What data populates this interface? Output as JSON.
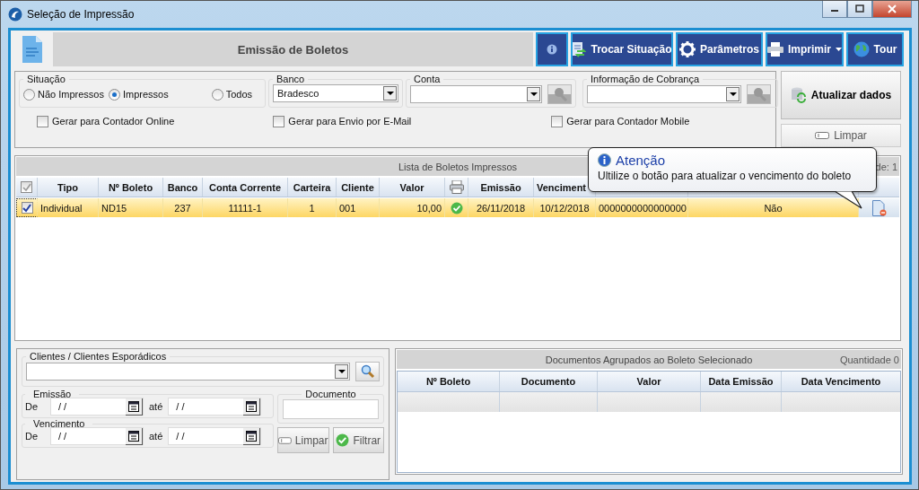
{
  "window": {
    "title": "Seleção de Impressão"
  },
  "header": {
    "title": "Emissão de Boletos",
    "buttons": [
      {
        "kind": "info"
      },
      {
        "kind": "swap",
        "label": "Trocar Situação"
      },
      {
        "kind": "gear",
        "label": "Parâmetros"
      },
      {
        "kind": "printer",
        "label": "Imprimir",
        "dropdown": true
      },
      {
        "kind": "globe",
        "label": "Tour"
      }
    ]
  },
  "filters": {
    "situacao": {
      "label": "Situação",
      "options": [
        {
          "label": "Não Impressos",
          "selected": false
        },
        {
          "label": "Impressos",
          "selected": true
        },
        {
          "label": "Todos",
          "selected": false
        }
      ]
    },
    "banco": {
      "label": "Banco",
      "value": "Bradesco"
    },
    "conta": {
      "label": "Conta"
    },
    "cobranca": {
      "label": "Informação de Cobrança"
    },
    "checkboxes": [
      {
        "label": "Gerar para Contador Online",
        "checked": false
      },
      {
        "label": "Gerar para Envio por E-Mail",
        "checked": false
      },
      {
        "label": "Gerar para Contador Mobile",
        "checked": false
      }
    ]
  },
  "actions": {
    "refresh": "Atualizar dados",
    "clear": "Limpar"
  },
  "list": {
    "title": "Lista de Boletos Impressos",
    "count": "de: 1",
    "all_checked": true,
    "columns": [
      {
        "label": "Tipo"
      },
      {
        "label": "Nº Boleto"
      },
      {
        "label": "Banco"
      },
      {
        "label": "Conta Corrente"
      },
      {
        "label": "Carteira"
      },
      {
        "label": "Cliente"
      },
      {
        "label": "Valor"
      },
      {
        "kind": "printer"
      },
      {
        "label": "Emissão"
      },
      {
        "label": "Venciment"
      }
    ],
    "rows": [
      {
        "checked": true,
        "selected": true,
        "printed": true,
        "cells": [
          "Individual",
          "ND15",
          "237",
          "11111-1",
          "1",
          "001",
          "10,00",
          "",
          "26/11/2018",
          "10/12/2018",
          "0000000000000000",
          "Não"
        ]
      }
    ]
  },
  "tooltip": {
    "title": "Atenção",
    "text": "Ultilize o botão para atualizar o vencimento do boleto"
  },
  "search": {
    "clients": {
      "label": "Clientes / Clientes Esporádicos"
    },
    "dates": [
      {
        "label": "Emissão",
        "from_label": "De",
        "from": "/ /",
        "to_label": "até",
        "to": "/ /"
      },
      {
        "label": "Vencimento",
        "from_label": "De",
        "from": "/ /",
        "to_label": "até",
        "to": "/ /"
      }
    ],
    "documento": {
      "label": "Documento"
    },
    "clear": "Limpar",
    "filter": "Filtrar"
  },
  "grouped": {
    "title": "Documentos Agrupados ao Boleto Selecionado",
    "count": "Quantidade 0",
    "columns": [
      "Nº Boleto",
      "Documento",
      "Valor",
      "Data Emissão",
      "Data Vencimento"
    ]
  }
}
